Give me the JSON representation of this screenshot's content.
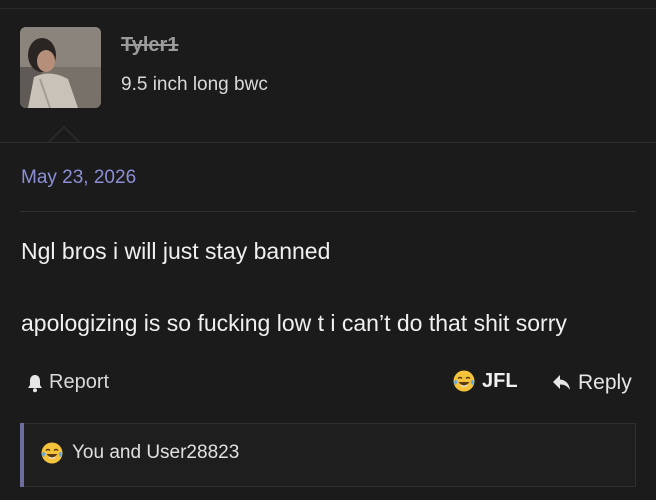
{
  "post": {
    "author": {
      "username": "Tyler1",
      "title": "9.5 inch long bwc"
    },
    "date": "May 23, 2026",
    "body_lines": [
      "Ngl bros i will just stay banned",
      "apologizing is so fucking low t i can’t do that shit sorry"
    ]
  },
  "actions": {
    "report_label": "Report",
    "reaction_label": "JFL",
    "reply_label": "Reply",
    "icons": {
      "report": "bell-icon",
      "reaction": "tears-of-joy-emoji-icon",
      "reply": "reply-arrow-icon"
    }
  },
  "reactions": {
    "summary": "You and User28823",
    "icon": "tears-of-joy-emoji-icon"
  },
  "colors": {
    "background": "#1b1b1b",
    "date": "#8c8fd6",
    "quote_bar": "#6e6e9c"
  }
}
